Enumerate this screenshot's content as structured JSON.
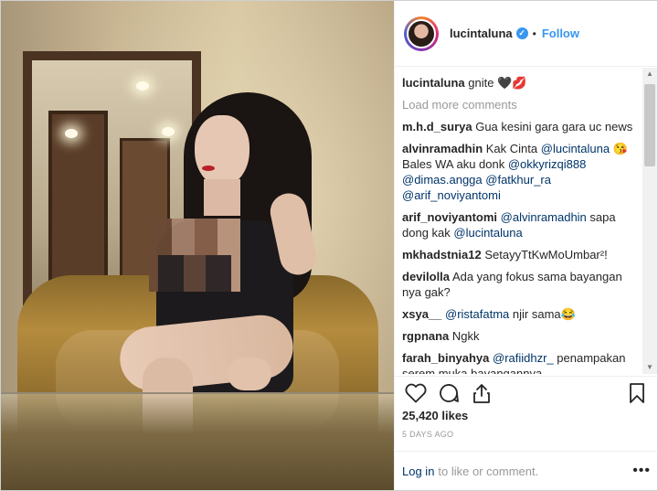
{
  "header": {
    "username": "lucintaluna",
    "verified_glyph": "✓",
    "separator": "•",
    "follow_label": "Follow"
  },
  "caption": {
    "username": "lucintaluna",
    "text": "gnite 🖤💋"
  },
  "load_more_label": "Load more comments",
  "comments": [
    {
      "user": "m.h.d_surya",
      "text": "Gua kesini gara gara uc news"
    },
    {
      "user": "alvinramadhin",
      "parts": [
        {
          "t": "Kak Cinta ",
          "m": false
        },
        {
          "t": "@lucintaluna",
          "m": true
        },
        {
          "t": " 😘 Bales WA aku donk ",
          "m": false
        },
        {
          "t": "@okkyrizqi888",
          "m": true
        },
        {
          "t": " ",
          "m": false
        },
        {
          "t": "@dimas.angga",
          "m": true
        },
        {
          "t": " ",
          "m": false
        },
        {
          "t": "@fatkhur_ra",
          "m": true
        },
        {
          "t": " ",
          "m": false
        },
        {
          "t": "@arif_noviyantomi",
          "m": true
        }
      ]
    },
    {
      "user": "arif_noviyantomi",
      "parts": [
        {
          "t": "@alvinramadhin",
          "m": true
        },
        {
          "t": " sapa dong kak ",
          "m": false
        },
        {
          "t": "@lucintaluna",
          "m": true
        }
      ]
    },
    {
      "user": "mkhadstnia12",
      "text": "SetayyTtKwMoUmbar²!"
    },
    {
      "user": "devilolla",
      "text": "Ada yang fokus sama bayangan nya gak?"
    },
    {
      "user": "xsya__",
      "parts": [
        {
          "t": "@ristafatma",
          "m": true
        },
        {
          "t": " njir sama😂",
          "m": false
        }
      ]
    },
    {
      "user": "rgpnana",
      "text": "Ngkk"
    },
    {
      "user": "farah_binyahya",
      "parts": [
        {
          "t": "@rafiidhzr_",
          "m": true
        },
        {
          "t": " penampakan serem muka bayangannya",
          "m": false
        }
      ]
    }
  ],
  "actions": {
    "like_icon": "heart-icon",
    "comment_icon": "comment-icon",
    "share_icon": "share-icon",
    "save_icon": "bookmark-icon"
  },
  "likes": "25,420 likes",
  "time_ago": "5 DAYS AGO",
  "login": {
    "link_label": "Log in",
    "rest_text": "to like or comment.",
    "more_label": "•••"
  },
  "scrollbar": {
    "up": "▲",
    "down": "▼"
  }
}
